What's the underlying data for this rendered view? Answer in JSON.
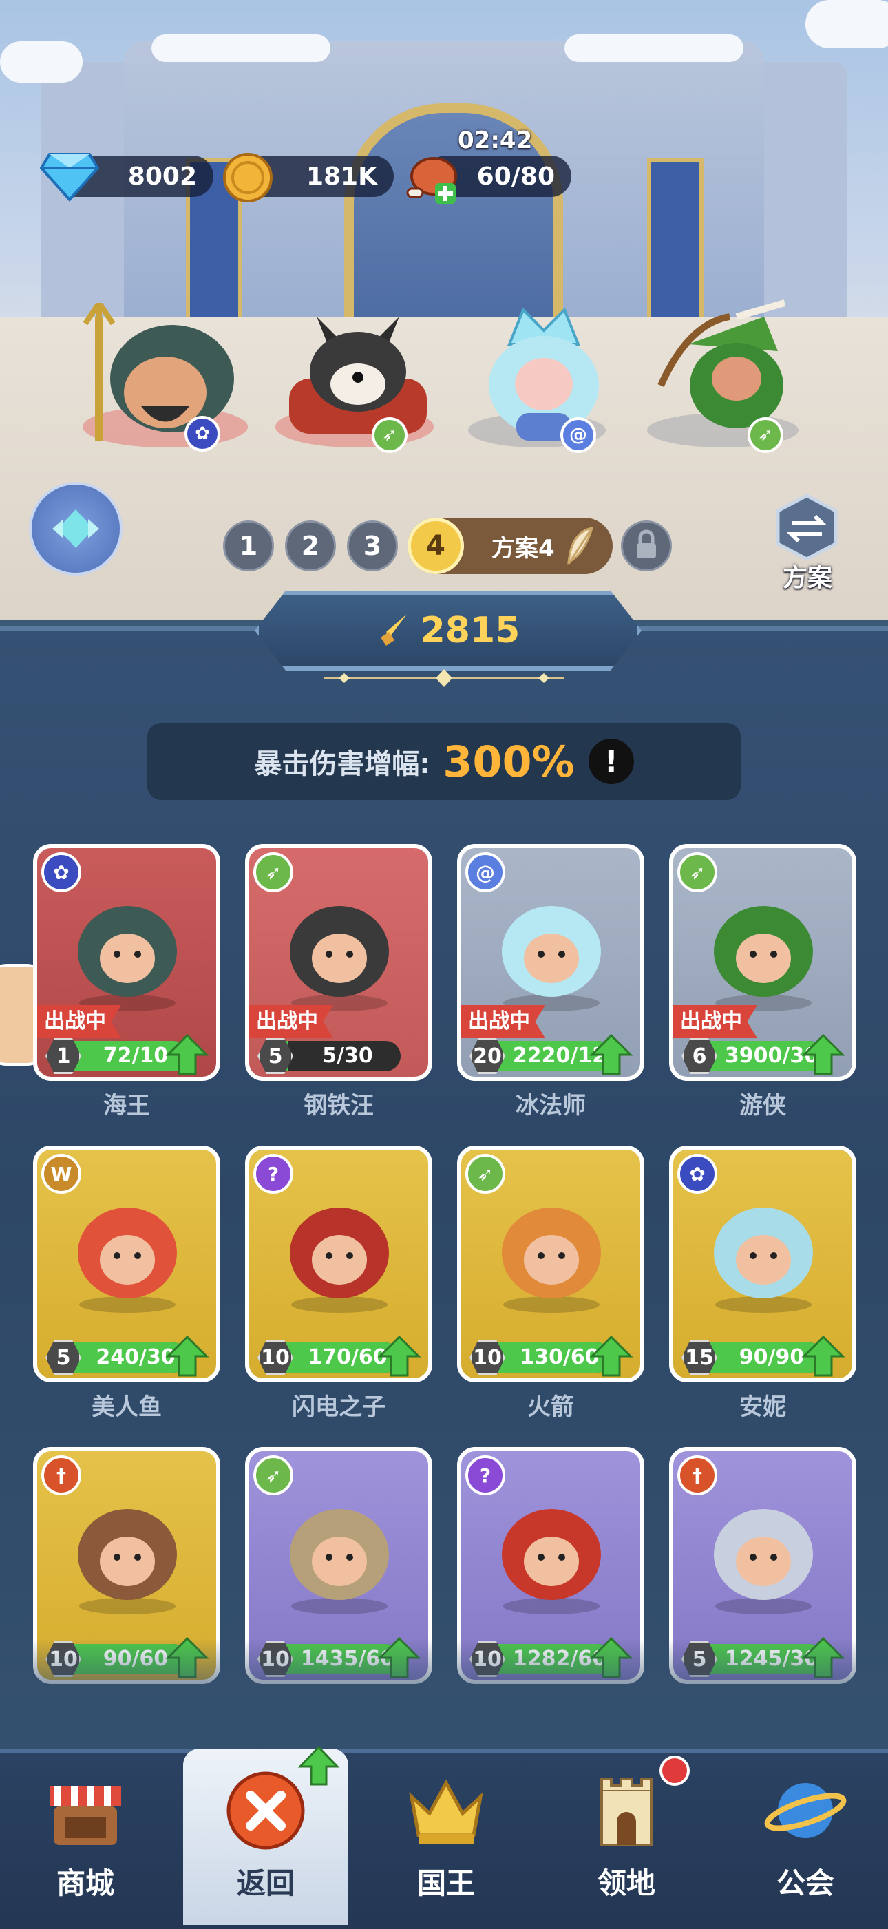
{
  "resources": {
    "gems": "8002",
    "coins": "181K",
    "energy": "60/80",
    "energy_timer": "02:42"
  },
  "loadout": {
    "slots": [
      "1",
      "2",
      "3"
    ],
    "active_slot": "4",
    "active_label": "方案4",
    "scheme_button_label": "方案"
  },
  "power": "2815",
  "crit": {
    "label": "暴击伤害增幅:",
    "value": "300%",
    "info_icon": "!"
  },
  "heroes": [
    {
      "name": "海王",
      "level": "1",
      "progress": "72/10",
      "progress_frac": 1.0,
      "deployed": true,
      "status": "出战中",
      "class_icon": "paw-icon",
      "card": "red",
      "badge_color": "#3b4bc0"
    },
    {
      "name": "钢铁汪",
      "level": "5",
      "progress": "5/30",
      "progress_frac": 0.17,
      "deployed": true,
      "status": "出战中",
      "class_icon": "bow-icon",
      "card": "red2",
      "badge_color": "#6cb84a"
    },
    {
      "name": "冰法师",
      "level": "20",
      "progress": "2220/12",
      "progress_frac": 1.0,
      "deployed": true,
      "status": "出战中",
      "class_icon": "swirl-icon",
      "card": "grey",
      "badge_color": "#5b7fe0"
    },
    {
      "name": "游侠",
      "level": "6",
      "progress": "3900/30",
      "progress_frac": 1.0,
      "deployed": true,
      "status": "出战中",
      "class_icon": "bow-icon",
      "card": "grey",
      "badge_color": "#6cb84a"
    },
    {
      "name": "美人鱼",
      "level": "5",
      "progress": "240/30",
      "progress_frac": 1.0,
      "deployed": false,
      "status": "",
      "class_icon": "wings-icon",
      "card": "gold",
      "badge_color": "#c98a2a"
    },
    {
      "name": "闪电之子",
      "level": "10",
      "progress": "170/60",
      "progress_frac": 1.0,
      "deployed": false,
      "status": "",
      "class_icon": "staff-icon",
      "card": "gold",
      "badge_color": "#8a4ad6"
    },
    {
      "name": "火箭",
      "level": "10",
      "progress": "130/60",
      "progress_frac": 1.0,
      "deployed": false,
      "status": "",
      "class_icon": "bow-icon",
      "card": "gold",
      "badge_color": "#6cb84a"
    },
    {
      "name": "安妮",
      "level": "15",
      "progress": "90/90",
      "progress_frac": 1.0,
      "deployed": false,
      "status": "",
      "class_icon": "paw-icon",
      "card": "gold",
      "badge_color": "#3b4bc0"
    },
    {
      "name": "",
      "level": "10",
      "progress": "90/60",
      "progress_frac": 1.0,
      "deployed": false,
      "status": "",
      "class_icon": "sword-icon",
      "card": "gold",
      "badge_color": "#d9532a"
    },
    {
      "name": "",
      "level": "10",
      "progress": "1435/60",
      "progress_frac": 1.0,
      "deployed": false,
      "status": "",
      "class_icon": "bow-icon",
      "card": "purple",
      "badge_color": "#6cb84a"
    },
    {
      "name": "",
      "level": "10",
      "progress": "1282/60",
      "progress_frac": 1.0,
      "deployed": false,
      "status": "",
      "class_icon": "staff-icon",
      "card": "purple",
      "badge_color": "#8a4ad6"
    },
    {
      "name": "",
      "level": "5",
      "progress": "1245/30",
      "progress_frac": 1.0,
      "deployed": false,
      "status": "",
      "class_icon": "sword-icon",
      "card": "purple",
      "badge_color": "#d9532a"
    }
  ],
  "nav": [
    {
      "label": "商城",
      "icon": "shop-icon",
      "active": false,
      "badge": false
    },
    {
      "label": "返回",
      "icon": "close-icon",
      "active": true,
      "badge": false
    },
    {
      "label": "国王",
      "icon": "crown-icon",
      "active": false,
      "badge": false
    },
    {
      "label": "领地",
      "icon": "castle-icon",
      "active": false,
      "badge": true
    },
    {
      "label": "公会",
      "icon": "planet-icon",
      "active": false,
      "badge": false
    }
  ]
}
